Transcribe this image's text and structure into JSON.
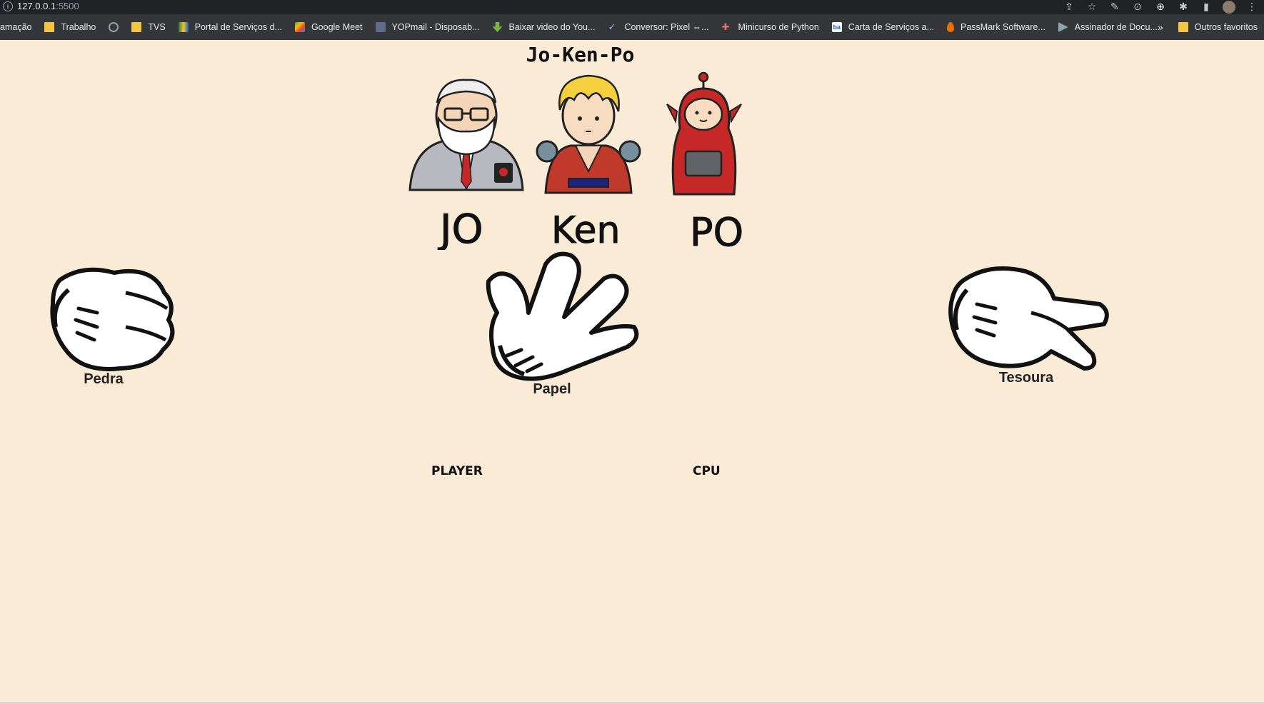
{
  "browser": {
    "url_host": "127.0.0.1",
    "url_port": ":5500",
    "bookmarks": [
      {
        "label": "amação",
        "icon": "none"
      },
      {
        "label": "Trabalho",
        "icon": "folder"
      },
      {
        "label": "",
        "icon": "globe"
      },
      {
        "label": "TVS",
        "icon": "folder"
      },
      {
        "label": "Portal de Serviços d...",
        "icon": "portal"
      },
      {
        "label": "Google Meet",
        "icon": "meet"
      },
      {
        "label": "YOPmail - Disposab...",
        "icon": "yopmail"
      },
      {
        "label": "Baixar video do You...",
        "icon": "download"
      },
      {
        "label": "Conversor: Pixel ⇔...",
        "icon": "check"
      },
      {
        "label": "Minicurso de Python",
        "icon": "python"
      },
      {
        "label": "Carta de Serviços a...",
        "icon": "ba"
      },
      {
        "label": "PassMark Software...",
        "icon": "flame"
      },
      {
        "label": "Assinador de Docu...",
        "icon": "signer"
      }
    ],
    "more": "»",
    "other_favorites": "Outros favoritos"
  },
  "game": {
    "title": "Jo-Ken-Po",
    "characters": [
      "JO",
      "KEN",
      "PO"
    ],
    "choices": {
      "rock": "Pedra",
      "paper": "Papel",
      "scissors": "Tesoura"
    },
    "player_label": "PLAYER",
    "cpu_label": "CPU"
  },
  "colors": {
    "background": "#faebd7",
    "ken_shirt": "#c0392b",
    "po_body": "#c62828"
  }
}
